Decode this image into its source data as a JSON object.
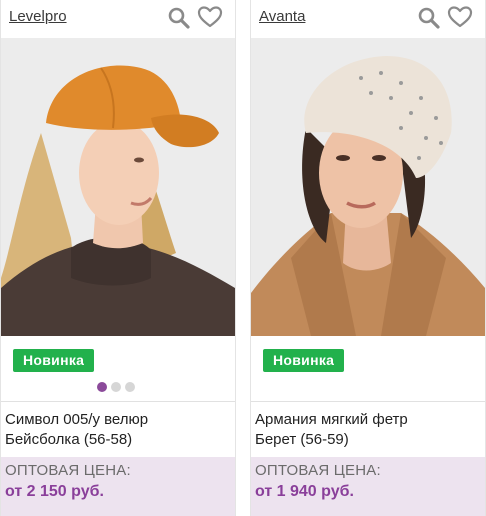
{
  "products": [
    {
      "brand": "Levelpro",
      "image": {
        "description_icon": "woman-in-orange-cap-photo",
        "background": "#ececec",
        "hat_color": "#e08a2c",
        "top_color": "#4a3b36",
        "hair_color": "#d8b57a"
      },
      "badge": "Новинка",
      "gallery_dots": {
        "total": 3,
        "active": 1
      },
      "title_line1": "Символ 005/у велюр",
      "title_line2": "Бейсболка (56-58)",
      "price_label": "ОПТОВАЯ ЦЕНА:",
      "price": "от 2 150 руб."
    },
    {
      "brand": "Avanta",
      "image": {
        "description_icon": "woman-in-beret-photo",
        "background": "#ececec",
        "hat_color": "#ece3d8",
        "top_color": "#c18a5a",
        "hair_color": "#3a2a22"
      },
      "badge": "Новинка",
      "title_line1": "Армания мягкий фетр",
      "title_line2": "Берет (56-59)",
      "price_label": "ОПТОВАЯ ЦЕНА:",
      "price": "от 1 940 руб."
    }
  ],
  "colors": {
    "badge_green": "#22b14c",
    "price_bg": "#ede3ef",
    "price_text": "#8a3f9a",
    "dot_active": "#8b4a9a"
  }
}
